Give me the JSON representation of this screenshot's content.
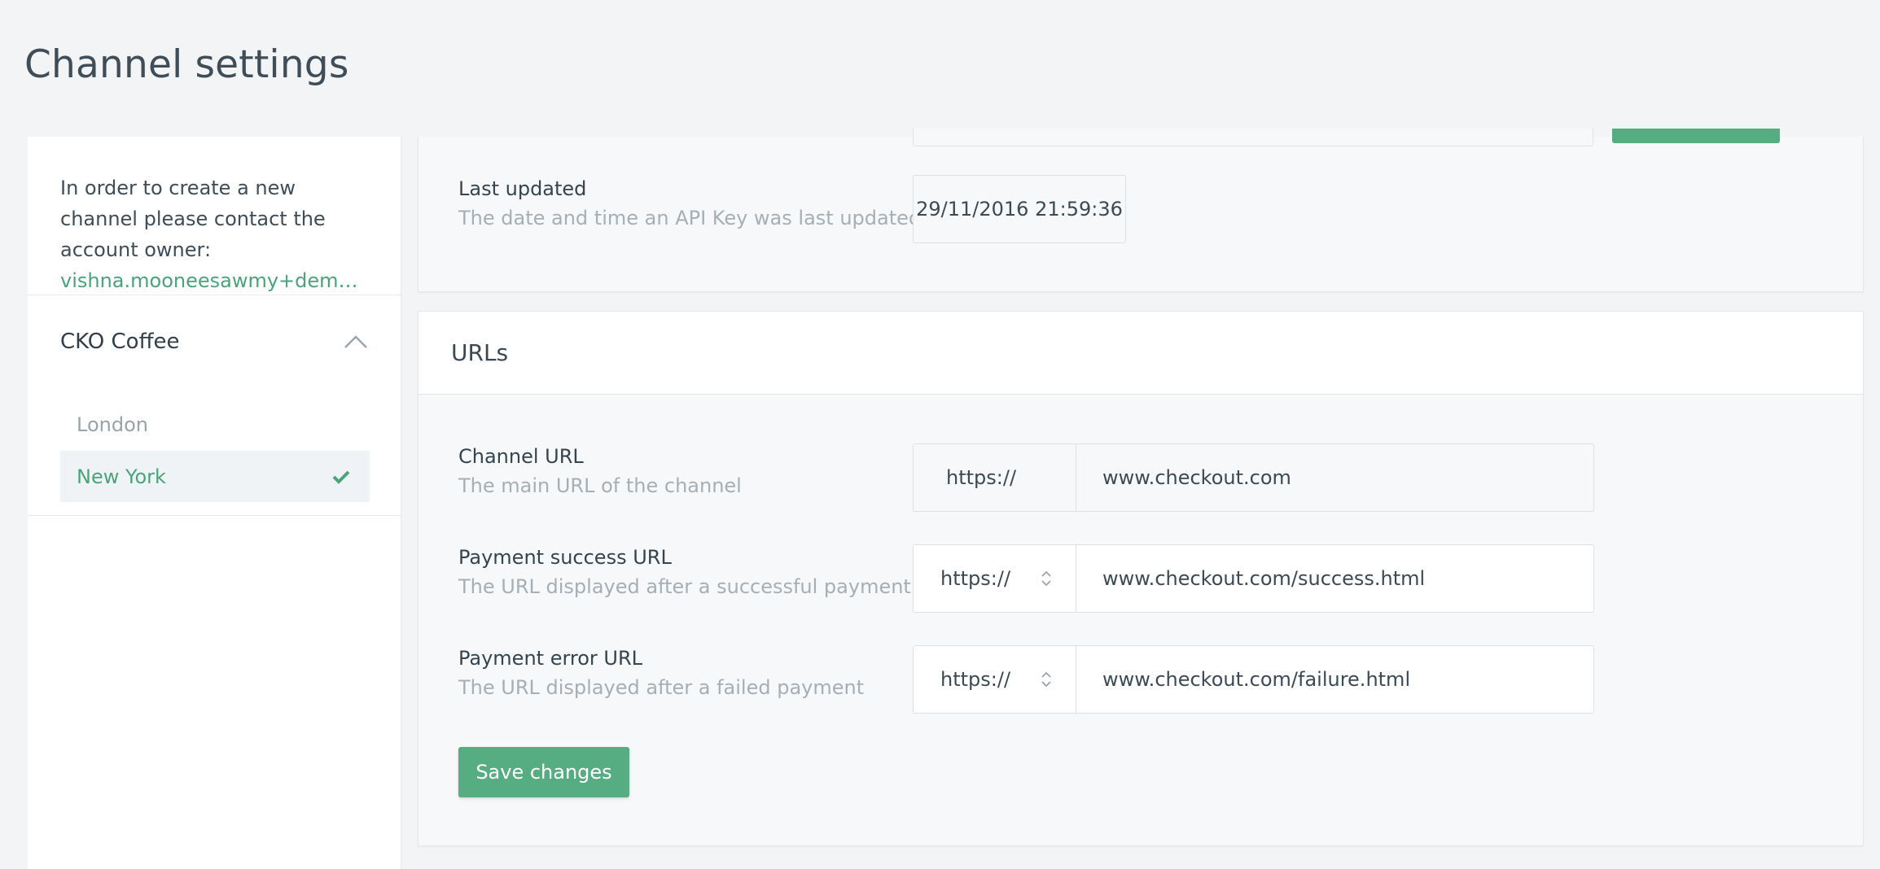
{
  "page": {
    "title": "Channel settings"
  },
  "sidebar": {
    "info_text": "In order to create a new channel please contact the account owner:",
    "owner_email": "vishna.mooneesawmy+demoad...",
    "group": {
      "title": "CKO Coffee",
      "items": [
        {
          "label": "London",
          "selected": false
        },
        {
          "label": "New York",
          "selected": true
        }
      ]
    }
  },
  "api_keys": {
    "last_updated": {
      "label": "Last updated",
      "help": "The date and time an API Key was last updated",
      "value": "29/11/2016 21:59:36"
    }
  },
  "urls": {
    "title": "URLs",
    "channel_url": {
      "label": "Channel URL",
      "help": "The main URL of the channel",
      "protocol": "https://",
      "value": "www.checkout.com"
    },
    "success_url": {
      "label": "Payment success URL",
      "help": "The URL displayed after a successful payment",
      "protocol": "https://",
      "value": "www.checkout.com/success.html"
    },
    "error_url": {
      "label": "Payment error URL",
      "help": "The URL displayed after a failed payment",
      "protocol": "https://",
      "value": "www.checkout.com/failure.html"
    },
    "save_label": "Save changes"
  },
  "colors": {
    "accent": "#56ad82",
    "link": "#4aa47a"
  }
}
